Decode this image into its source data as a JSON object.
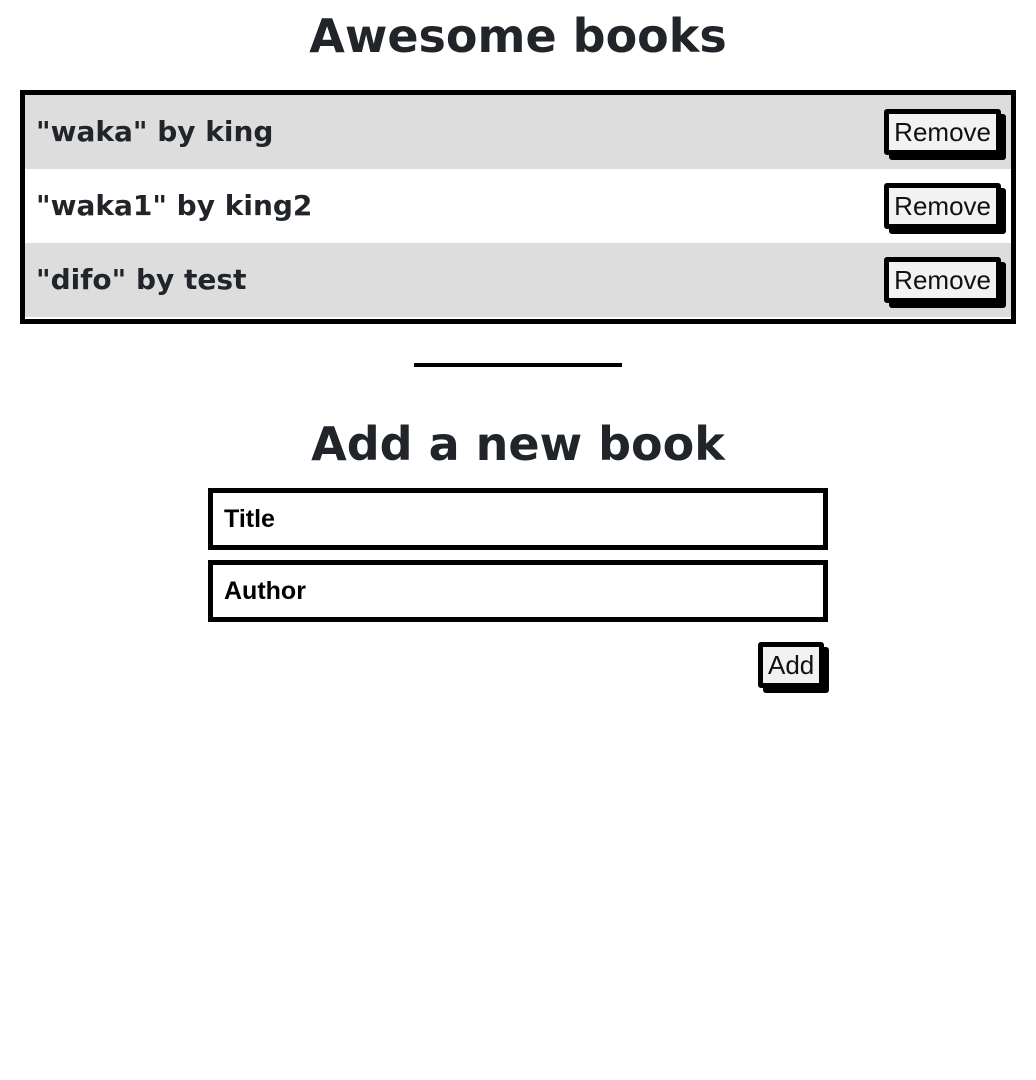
{
  "header": {
    "title": "Awesome books"
  },
  "books": [
    {
      "text": "\"waka\" by king",
      "remove_label": "Remove"
    },
    {
      "text": "\"waka1\" by king2",
      "remove_label": "Remove"
    },
    {
      "text": "\"difo\" by test",
      "remove_label": "Remove"
    }
  ],
  "form": {
    "title": "Add a new book",
    "title_placeholder": "Title",
    "author_placeholder": "Author",
    "add_label": "Add"
  },
  "colors": {
    "row_alt": "#dddddd",
    "border": "#000000",
    "button_bg": "#f2f2f2"
  }
}
